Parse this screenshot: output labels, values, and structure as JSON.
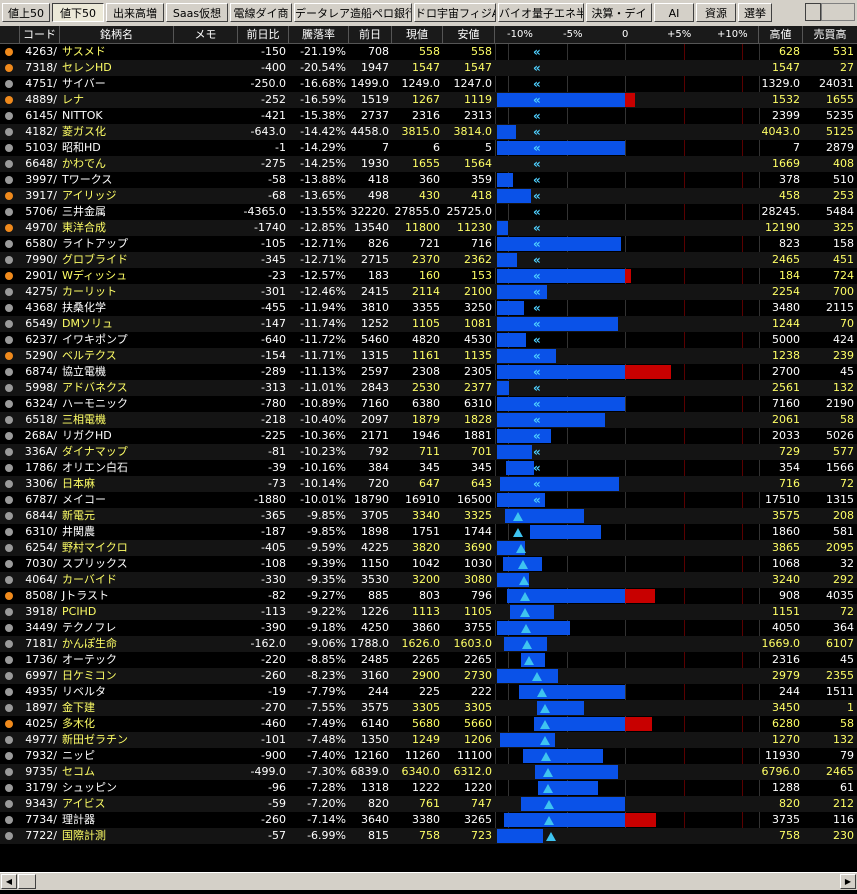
{
  "tabs": [
    {
      "label": "値上50",
      "active": false
    },
    {
      "label": "値下50",
      "active": true
    },
    {
      "label": "出来高増",
      "active": false
    },
    {
      "label": "Saas仮想",
      "active": false
    },
    {
      "label": "電線ダイ商",
      "active": false
    },
    {
      "label": "データレア造船ペロ銀行",
      "active": false
    },
    {
      "label": "ドロ宇宙フィジAI",
      "active": false
    },
    {
      "label": "バイオ量子エネ半導",
      "active": false
    },
    {
      "label": "決算・デイ",
      "active": false
    },
    {
      "label": "AI",
      "active": false
    },
    {
      "label": "資源",
      "active": false
    },
    {
      "label": "選挙",
      "active": false
    }
  ],
  "columns": {
    "code": "コード",
    "name": "銘柄名",
    "memo": "メモ",
    "change": "前日比",
    "rate": "騰落率",
    "prev": "前日",
    "price": "現値",
    "low": "安値",
    "high": "高値",
    "value": "売買高"
  },
  "scale_labels": [
    "-10%",
    "-5%",
    "0",
    "+5%",
    "+10%"
  ],
  "colors": {
    "name_yellow": "#ffff66",
    "bar_blue": "#0a52e8",
    "bar_red": "#c80000",
    "dot_orange": "#f08a1c",
    "dot_gray": "#9a9a9a"
  },
  "rows": [
    {
      "code": "4263/",
      "name": "サスメド",
      "change": "-150",
      "rate": "-21.19%",
      "prev": "708",
      "price": "558",
      "low": "558",
      "high": "628",
      "value": "531",
      "yellow": true,
      "dot": "orange",
      "lowpct": -21.19,
      "highpct": -11.3,
      "mark": "chev",
      "markpct": -8.0
    },
    {
      "code": "7318/",
      "name": "セレンHD",
      "change": "-400",
      "rate": "-20.54%",
      "prev": "1947",
      "price": "1547",
      "low": "1547",
      "high": "1547",
      "value": "27",
      "yellow": true,
      "dot": "orange",
      "lowpct": -20.54,
      "highpct": -20.54,
      "mark": "chev",
      "markpct": -8.0
    },
    {
      "code": "4751/",
      "name": "サイバー",
      "change": "-250.0",
      "rate": "-16.68%",
      "prev": "1499.0",
      "price": "1249.0",
      "low": "1247.0",
      "high": "1329.0",
      "value": "24031",
      "yellow": false,
      "dot": "gray",
      "lowpct": -16.81,
      "highpct": -11.34,
      "mark": "chev",
      "markpct": -8.0
    },
    {
      "code": "4889/",
      "name": "レナ",
      "change": "-252",
      "rate": "-16.59%",
      "prev": "1519",
      "price": "1267",
      "low": "1119",
      "high": "1532",
      "value": "1655",
      "yellow": true,
      "dot": "orange",
      "lowpct": -26.3,
      "highpct": 0.86,
      "mark": "chev",
      "markpct": -8.0
    },
    {
      "code": "6145/",
      "name": "NITTOK",
      "change": "-421",
      "rate": "-15.38%",
      "prev": "2737",
      "price": "2316",
      "low": "2313",
      "high": "2399",
      "value": "5235",
      "yellow": false,
      "dot": "gray",
      "lowpct": -15.49,
      "highpct": -12.35,
      "mark": "chev",
      "markpct": -8.0
    },
    {
      "code": "4182/",
      "name": "菱ガス化",
      "change": "-643.0",
      "rate": "-14.42%",
      "prev": "4458.0",
      "price": "3815.0",
      "low": "3814.0",
      "high": "4043.0",
      "value": "5125",
      "yellow": true,
      "dot": "gray",
      "lowpct": -14.45,
      "highpct": -9.31,
      "mark": "chev",
      "markpct": -8.0
    },
    {
      "code": "5103/",
      "name": "昭和HD",
      "change": "-1",
      "rate": "-14.29%",
      "prev": "7",
      "price": "6",
      "low": "5",
      "high": "7",
      "value": "2879",
      "yellow": false,
      "dot": "gray",
      "lowpct": -28.6,
      "highpct": 0.0,
      "mark": "chev",
      "markpct": -8.0
    },
    {
      "code": "6648/",
      "name": "かわでん",
      "change": "-275",
      "rate": "-14.25%",
      "prev": "1930",
      "price": "1655",
      "low": "1564",
      "high": "1669",
      "value": "408",
      "yellow": true,
      "dot": "gray",
      "lowpct": -18.96,
      "highpct": -13.5,
      "mark": "chev",
      "markpct": -8.0
    },
    {
      "code": "3997/",
      "name": "Tワークス",
      "change": "-58",
      "rate": "-13.88%",
      "prev": "418",
      "price": "360",
      "low": "359",
      "high": "378",
      "value": "510",
      "yellow": false,
      "dot": "gray",
      "lowpct": -14.1,
      "highpct": -9.6,
      "mark": "chev",
      "markpct": -8.0
    },
    {
      "code": "3917/",
      "name": "アイリッジ",
      "change": "-68",
      "rate": "-13.65%",
      "prev": "498",
      "price": "430",
      "low": "418",
      "high": "458",
      "value": "253",
      "yellow": true,
      "dot": "orange",
      "lowpct": -16.1,
      "highpct": -8.0,
      "mark": "chev",
      "markpct": -8.0
    },
    {
      "code": "5706/",
      "name": "三井金属",
      "change": "-4365.0",
      "rate": "-13.55%",
      "prev": "32220.",
      "price": "27855.0",
      "low": "25725.0",
      "high": "28245.",
      "value": "5484",
      "yellow": false,
      "dot": "gray",
      "lowpct": -20.2,
      "highpct": -12.3,
      "mark": "chev",
      "markpct": -8.0
    },
    {
      "code": "4970/",
      "name": "東洋合成",
      "change": "-1740",
      "rate": "-12.85%",
      "prev": "13540",
      "price": "11800",
      "low": "11230",
      "high": "12190",
      "value": "325",
      "yellow": true,
      "dot": "orange",
      "lowpct": -17.06,
      "highpct": -9.97,
      "mark": "chev",
      "markpct": -8.0
    },
    {
      "code": "6580/",
      "name": "ライトアップ",
      "change": "-105",
      "rate": "-12.71%",
      "prev": "826",
      "price": "721",
      "low": "716",
      "high": "823",
      "value": "158",
      "yellow": false,
      "dot": "gray",
      "lowpct": -13.3,
      "highpct": -0.36,
      "mark": "chev",
      "markpct": -8.0
    },
    {
      "code": "7990/",
      "name": "グロブライド",
      "change": "-345",
      "rate": "-12.71%",
      "prev": "2715",
      "price": "2370",
      "low": "2362",
      "high": "2465",
      "value": "451",
      "yellow": true,
      "dot": "gray",
      "lowpct": -13.0,
      "highpct": -9.2,
      "mark": "chev",
      "markpct": -8.0
    },
    {
      "code": "2901/",
      "name": "Wディッシュ",
      "change": "-23",
      "rate": "-12.57%",
      "prev": "183",
      "price": "160",
      "low": "153",
      "high": "184",
      "value": "724",
      "yellow": true,
      "dot": "orange",
      "lowpct": -16.4,
      "highpct": 0.55,
      "mark": "chev",
      "markpct": -8.0
    },
    {
      "code": "4275/",
      "name": "カーリット",
      "change": "-301",
      "rate": "-12.46%",
      "prev": "2415",
      "price": "2114",
      "low": "2100",
      "high": "2254",
      "value": "700",
      "yellow": true,
      "dot": "gray",
      "lowpct": -13.0,
      "highpct": -6.67,
      "mark": "chev",
      "markpct": -8.0
    },
    {
      "code": "4368/",
      "name": "扶桑化学",
      "change": "-455",
      "rate": "-11.94%",
      "prev": "3810",
      "price": "3355",
      "low": "3250",
      "high": "3480",
      "value": "2115",
      "yellow": false,
      "dot": "gray",
      "lowpct": -14.7,
      "highpct": -8.66,
      "mark": "chev",
      "markpct": -8.0
    },
    {
      "code": "6549/",
      "name": "DMソリュ",
      "change": "-147",
      "rate": "-11.74%",
      "prev": "1252",
      "price": "1105",
      "low": "1081",
      "high": "1244",
      "value": "70",
      "yellow": true,
      "dot": "gray",
      "lowpct": -13.66,
      "highpct": -0.64,
      "mark": "chev",
      "markpct": -8.0
    },
    {
      "code": "6237/",
      "name": "イワキポンプ",
      "change": "-640",
      "rate": "-11.72%",
      "prev": "5460",
      "price": "4820",
      "low": "4530",
      "high": "5000",
      "value": "424",
      "yellow": false,
      "dot": "gray",
      "lowpct": -17.03,
      "highpct": -8.42,
      "mark": "chev",
      "markpct": -8.0
    },
    {
      "code": "5290/",
      "name": "ベルテクス",
      "change": "-154",
      "rate": "-11.71%",
      "prev": "1315",
      "price": "1161",
      "low": "1135",
      "high": "1238",
      "value": "239",
      "yellow": true,
      "dot": "orange",
      "lowpct": -13.7,
      "highpct": -5.86,
      "mark": "chev",
      "markpct": -8.0
    },
    {
      "code": "6874/",
      "name": "協立電機",
      "change": "-289",
      "rate": "-11.13%",
      "prev": "2597",
      "price": "2308",
      "low": "2305",
      "high": "2700",
      "value": "45",
      "yellow": false,
      "dot": "gray",
      "lowpct": -11.24,
      "highpct": 3.97,
      "mark": "chev",
      "markpct": -8.0
    },
    {
      "code": "5998/",
      "name": "アドバネクス",
      "change": "-313",
      "rate": "-11.01%",
      "prev": "2843",
      "price": "2530",
      "low": "2377",
      "high": "2561",
      "value": "132",
      "yellow": true,
      "dot": "gray",
      "lowpct": -16.4,
      "highpct": -9.92,
      "mark": "chev",
      "markpct": -8.0
    },
    {
      "code": "6324/",
      "name": "ハーモニック",
      "change": "-780",
      "rate": "-10.89%",
      "prev": "7160",
      "price": "6380",
      "low": "6310",
      "high": "7160",
      "value": "2190",
      "yellow": false,
      "dot": "gray",
      "lowpct": -11.87,
      "highpct": 0.0,
      "mark": "chev",
      "markpct": -8.0
    },
    {
      "code": "6518/",
      "name": "三相電機",
      "change": "-218",
      "rate": "-10.40%",
      "prev": "2097",
      "price": "1879",
      "low": "1828",
      "high": "2061",
      "value": "58",
      "yellow": true,
      "dot": "gray",
      "lowpct": -12.83,
      "highpct": -1.72,
      "mark": "chev",
      "markpct": -8.0
    },
    {
      "code": "268A/",
      "name": "リガクHD",
      "change": "-225",
      "rate": "-10.36%",
      "prev": "2171",
      "price": "1946",
      "low": "1881",
      "high": "2033",
      "value": "5026",
      "yellow": false,
      "dot": "gray",
      "lowpct": -13.36,
      "highpct": -6.36,
      "mark": "chev",
      "markpct": -8.0
    },
    {
      "code": "336A/",
      "name": "ダイナマップ",
      "change": "-81",
      "rate": "-10.23%",
      "prev": "792",
      "price": "711",
      "low": "701",
      "high": "729",
      "value": "577",
      "yellow": true,
      "dot": "gray",
      "lowpct": -11.5,
      "highpct": -7.95,
      "mark": "chev",
      "markpct": -8.0
    },
    {
      "code": "1786/",
      "name": "オリエン白石",
      "change": "-39",
      "rate": "-10.16%",
      "prev": "384",
      "price": "345",
      "low": "345",
      "high": "354",
      "value": "1566",
      "yellow": false,
      "dot": "gray",
      "lowpct": -10.16,
      "highpct": -7.8,
      "mark": "chev",
      "markpct": -8.0
    },
    {
      "code": "3306/",
      "name": "日本麻",
      "change": "-73",
      "rate": "-10.14%",
      "prev": "720",
      "price": "647",
      "low": "643",
      "high": "716",
      "value": "72",
      "yellow": true,
      "dot": "gray",
      "lowpct": -10.7,
      "highpct": -0.56,
      "mark": "chev",
      "markpct": -8.0
    },
    {
      "code": "6787/",
      "name": "メイコー",
      "change": "-1880",
      "rate": "-10.01%",
      "prev": "18790",
      "price": "16910",
      "low": "16500",
      "high": "17510",
      "value": "1315",
      "yellow": false,
      "dot": "gray",
      "lowpct": -12.19,
      "highpct": -6.81,
      "mark": "chev",
      "markpct": -8.0
    },
    {
      "code": "6844/",
      "name": "新電元",
      "change": "-365",
      "rate": "-9.85%",
      "prev": "3705",
      "price": "3340",
      "low": "3325",
      "high": "3575",
      "value": "208",
      "yellow": true,
      "dot": "gray",
      "lowpct": -10.26,
      "highpct": -3.51,
      "mark": "tri",
      "markpct": -9.85
    },
    {
      "code": "6310/",
      "name": "井関農",
      "change": "-187",
      "rate": "-9.85%",
      "prev": "1898",
      "price": "1751",
      "low": "1744",
      "high": "1860",
      "value": "581",
      "yellow": false,
      "dot": "gray",
      "lowpct": -8.11,
      "highpct": -2.0,
      "mark": "tri",
      "markpct": -9.85
    },
    {
      "code": "6254/",
      "name": "野村マイクロ",
      "change": "-405",
      "rate": "-9.59%",
      "prev": "4225",
      "price": "3820",
      "low": "3690",
      "high": "3865",
      "value": "2095",
      "yellow": true,
      "dot": "gray",
      "lowpct": -12.66,
      "highpct": -8.52,
      "mark": "tri",
      "markpct": -9.59
    },
    {
      "code": "7030/",
      "name": "スプリックス",
      "change": "-108",
      "rate": "-9.39%",
      "prev": "1150",
      "price": "1042",
      "low": "1030",
      "high": "1068",
      "value": "32",
      "yellow": false,
      "dot": "gray",
      "lowpct": -10.43,
      "highpct": -7.13,
      "mark": "tri",
      "markpct": -9.39
    },
    {
      "code": "4064/",
      "name": "カーバイド",
      "change": "-330",
      "rate": "-9.35%",
      "prev": "3530",
      "price": "3200",
      "low": "3080",
      "high": "3240",
      "value": "292",
      "yellow": true,
      "dot": "gray",
      "lowpct": -12.75,
      "highpct": -8.22,
      "mark": "tri",
      "markpct": -9.35
    },
    {
      "code": "8508/",
      "name": "Jトラスト",
      "change": "-82",
      "rate": "-9.27%",
      "prev": "885",
      "price": "803",
      "low": "796",
      "high": "908",
      "value": "4035",
      "yellow": false,
      "dot": "orange",
      "lowpct": -10.06,
      "highpct": 2.6,
      "mark": "tri",
      "markpct": -9.27
    },
    {
      "code": "3918/",
      "name": "PCIHD",
      "change": "-113",
      "rate": "-9.22%",
      "prev": "1226",
      "price": "1113",
      "low": "1105",
      "high": "1151",
      "value": "72",
      "yellow": true,
      "dot": "gray",
      "lowpct": -9.87,
      "highpct": -6.12,
      "mark": "tri",
      "markpct": -9.22
    },
    {
      "code": "3449/",
      "name": "テクノフレ",
      "change": "-390",
      "rate": "-9.18%",
      "prev": "4250",
      "price": "3860",
      "low": "3755",
      "high": "4050",
      "value": "364",
      "yellow": false,
      "dot": "gray",
      "lowpct": -11.65,
      "highpct": -4.71,
      "mark": "tri",
      "markpct": -9.18
    },
    {
      "code": "7181/",
      "name": "かんぽ生命",
      "change": "-162.0",
      "rate": "-9.06%",
      "prev": "1788.0",
      "price": "1626.0",
      "low": "1603.0",
      "high": "1669.0",
      "value": "6107",
      "yellow": true,
      "dot": "gray",
      "lowpct": -10.35,
      "highpct": -6.66,
      "mark": "tri",
      "markpct": -9.06
    },
    {
      "code": "1736/",
      "name": "オーテック",
      "change": "-220",
      "rate": "-8.85%",
      "prev": "2485",
      "price": "2265",
      "low": "2265",
      "high": "2316",
      "value": "45",
      "yellow": false,
      "dot": "gray",
      "lowpct": -8.85,
      "highpct": -6.8,
      "mark": "tri",
      "markpct": -8.85
    },
    {
      "code": "6997/",
      "name": "日ケミコン",
      "change": "-260",
      "rate": "-8.23%",
      "prev": "3160",
      "price": "2900",
      "low": "2730",
      "high": "2979",
      "value": "2355",
      "yellow": true,
      "dot": "gray",
      "lowpct": -13.61,
      "highpct": -5.73,
      "mark": "tri",
      "markpct": -8.23
    },
    {
      "code": "4935/",
      "name": "リベルタ",
      "change": "-19",
      "rate": "-7.79%",
      "prev": "244",
      "price": "225",
      "low": "222",
      "high": "244",
      "value": "1511",
      "yellow": false,
      "dot": "gray",
      "lowpct": -9.02,
      "highpct": 0.0,
      "mark": "tri",
      "markpct": -7.79
    },
    {
      "code": "1897/",
      "name": "金下建",
      "change": "-270",
      "rate": "-7.55%",
      "prev": "3575",
      "price": "3305",
      "low": "3305",
      "high": "3450",
      "value": "1",
      "yellow": true,
      "dot": "gray",
      "lowpct": -7.55,
      "highpct": -3.5,
      "mark": "tri",
      "markpct": -7.55
    },
    {
      "code": "4025/",
      "name": "多木化",
      "change": "-460",
      "rate": "-7.49%",
      "prev": "6140",
      "price": "5680",
      "low": "5660",
      "high": "6280",
      "value": "58",
      "yellow": true,
      "dot": "orange",
      "lowpct": -7.82,
      "highpct": 2.28,
      "mark": "tri",
      "markpct": -7.49
    },
    {
      "code": "4977/",
      "name": "新田ゼラチン",
      "change": "-101",
      "rate": "-7.48%",
      "prev": "1350",
      "price": "1249",
      "low": "1206",
      "high": "1270",
      "value": "132",
      "yellow": true,
      "dot": "gray",
      "lowpct": -10.67,
      "highpct": -5.93,
      "mark": "tri",
      "markpct": -7.48
    },
    {
      "code": "7932/",
      "name": "ニッピ",
      "change": "-900",
      "rate": "-7.40%",
      "prev": "12160",
      "price": "11260",
      "low": "11100",
      "high": "11930",
      "value": "79",
      "yellow": false,
      "dot": "gray",
      "lowpct": -8.72,
      "highpct": -1.89,
      "mark": "tri",
      "markpct": -7.4
    },
    {
      "code": "9735/",
      "name": "セコム",
      "change": "-499.0",
      "rate": "-7.30%",
      "prev": "6839.0",
      "price": "6340.0",
      "low": "6312.0",
      "high": "6796.0",
      "value": "2465",
      "yellow": true,
      "dot": "gray",
      "lowpct": -7.71,
      "highpct": -0.63,
      "mark": "tri",
      "markpct": -7.3
    },
    {
      "code": "3179/",
      "name": "シュッピン",
      "change": "-96",
      "rate": "-7.28%",
      "prev": "1318",
      "price": "1222",
      "low": "1220",
      "high": "1288",
      "value": "61",
      "yellow": false,
      "dot": "gray",
      "lowpct": -7.44,
      "highpct": -2.28,
      "mark": "tri",
      "markpct": -7.28
    },
    {
      "code": "9343/",
      "name": "アイビス",
      "change": "-59",
      "rate": "-7.20%",
      "prev": "820",
      "price": "761",
      "low": "747",
      "high": "820",
      "value": "212",
      "yellow": true,
      "dot": "gray",
      "lowpct": -8.9,
      "highpct": 0.0,
      "mark": "tri",
      "markpct": -7.2
    },
    {
      "code": "7734/",
      "name": "理計器",
      "change": "-260",
      "rate": "-7.14%",
      "prev": "3640",
      "price": "3380",
      "low": "3265",
      "high": "3735",
      "value": "116",
      "yellow": false,
      "dot": "gray",
      "lowpct": -10.3,
      "highpct": 2.61,
      "mark": "tri",
      "markpct": -7.14
    },
    {
      "code": "7722/",
      "name": "国際計測",
      "change": "-57",
      "rate": "-6.99%",
      "prev": "815",
      "price": "758",
      "low": "723",
      "high": "758",
      "value": "230",
      "yellow": true,
      "dot": "gray",
      "lowpct": -11.29,
      "highpct": -6.99,
      "mark": "tri",
      "markpct": -6.99
    }
  ]
}
